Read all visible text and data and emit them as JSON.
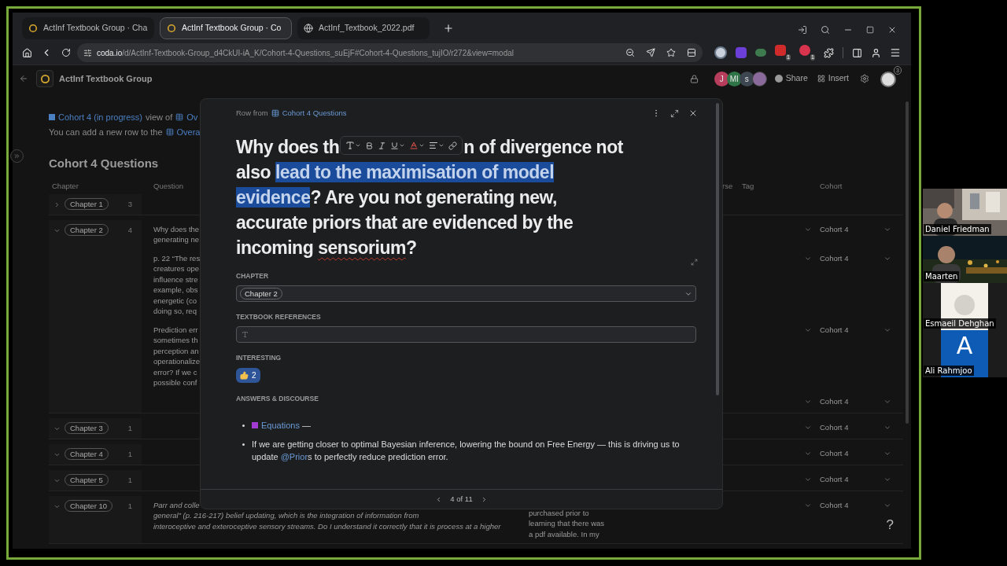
{
  "browser": {
    "tabs": [
      {
        "title": "ActInf Textbook Group · Cha",
        "kind": "doc",
        "selected": false
      },
      {
        "title": "ActInf Textbook Group · Co",
        "kind": "doc",
        "selected": true
      },
      {
        "title": "ActInf_Textbook_2022.pdf",
        "kind": "web",
        "selected": false
      }
    ],
    "url_host": "coda.io",
    "url_path": "/d/ActInf-Textbook-Group_d4CkUI-iA_K/Cohort-4-Questions_suEjF#Cohort-4-Questions_tujIO/r272&view=modal",
    "extension_badges": [
      "1",
      "1"
    ]
  },
  "doc": {
    "title": "ActInf Textbook Group",
    "members": [
      {
        "initial": "J",
        "color": "#b63d5c"
      },
      {
        "initial": "MI",
        "color": "#2e7446"
      },
      {
        "initial": "s",
        "color": "#3c4650"
      }
    ],
    "share": "Share",
    "insert": "Insert",
    "notification_count": "3"
  },
  "view": {
    "view_link": "Cohort 4 (in progress)",
    "view_of": "view of",
    "view_table": "Ov",
    "note": "You can add a new row to the",
    "note_table": "Overa",
    "heading": "Cohort 4 Questions",
    "columns": [
      "Chapter",
      "Question",
      "rse",
      "Tag",
      "Cohort"
    ],
    "groups": [
      {
        "chapter": "Chapter 1",
        "count": "3",
        "expanded": false
      },
      {
        "chapter": "Chapter 2",
        "count": "4",
        "expanded": true,
        "rows": [
          {
            "question_lines": [
              "Why does the",
              "generating ne"
            ],
            "italic": false,
            "cohort": "Cohort 4"
          },
          {
            "question_lines": [
              "p. 22 “The res",
              "creatures ope",
              "influence stre",
              "example, obs",
              "energetic (co",
              "doing so, req"
            ],
            "italic": false,
            "cohort": "Cohort 4"
          },
          {
            "question_lines": [
              "Prediction err",
              "sometimes th",
              "perception an",
              "operationalize",
              "error?  If we c",
              "possible conf"
            ],
            "italic": false,
            "cohort": "Cohort 4"
          },
          {
            "cohort": "Cohort 4"
          }
        ]
      },
      {
        "chapter": "Chapter 3",
        "count": "1",
        "expanded": true,
        "rows": [
          {
            "cohort": "Cohort 4"
          }
        ]
      },
      {
        "chapter": "Chapter 4",
        "count": "1",
        "expanded": true,
        "rows": [
          {
            "cohort": "Cohort 4"
          }
        ]
      },
      {
        "chapter": "Chapter 5",
        "count": "1",
        "expanded": true,
        "rows": [
          {
            "cohort": "Cohort 4"
          }
        ]
      },
      {
        "chapter": "Chapter 10",
        "count": "1",
        "expanded": true,
        "rows": [
          {
            "question_lines": [
              "Parr and colle",
              "general” (p. 216-217) belief updating, which is the integration of information from",
              "interoceptive and exteroceptive sensory streams. Do I understand it correctly that it is process at a higher"
            ],
            "italic": true,
            "column_3_lines": [
              "purchased prior to",
              "learning that there was",
              "a pdf available. In my"
            ],
            "cohort": "Cohort 4"
          }
        ]
      }
    ],
    "help": "?"
  },
  "modal": {
    "source_label": "Row from",
    "source_table": "Cohort 4 Questions",
    "title_lines": [
      [
        {
          "kind": "text",
          "text": "Why does th",
          "highlighted": false,
          "misspelled": false
        },
        {
          "kind": "toolbar"
        },
        {
          "kind": "text",
          "text": "n of divergence not",
          "highlighted": false,
          "misspelled": false
        }
      ],
      [
        {
          "kind": "text",
          "text": "also ",
          "highlighted": false,
          "misspelled": false
        },
        {
          "kind": "text",
          "text": "lead to the maximisation of model",
          "highlighted": true,
          "misspelled": false
        }
      ],
      [
        {
          "kind": "text",
          "text": "evidence",
          "highlighted": true,
          "misspelled": false
        },
        {
          "kind": "text",
          "text": "? Are you not generating new,",
          "highlighted": false,
          "misspelled": false
        }
      ],
      [
        {
          "kind": "text",
          "text": "accurate priors that are evidenced by the",
          "highlighted": false,
          "misspelled": false
        }
      ],
      [
        {
          "kind": "text",
          "text": "incoming ",
          "highlighted": false,
          "misspelled": false
        },
        {
          "kind": "text",
          "text": "sensorium",
          "highlighted": false,
          "misspelled": true
        },
        {
          "kind": "text",
          "text": "?",
          "highlighted": false,
          "misspelled": false
        }
      ]
    ],
    "chapter_label": "CHAPTER",
    "chapter_value": "Chapter 2",
    "references_label": "TEXTBOOK REFERENCES",
    "interesting_label": "INTERESTING",
    "reaction": {
      "count": "2",
      "reacted": true
    },
    "answers_label": "ANSWERS & DISCOURSE",
    "answers": [
      [
        {
          "text": "Equations",
          "link": true
        },
        {
          "text": " —",
          "link": false
        }
      ],
      [
        {
          "text": "If we are getting closer to optimal Bayesian inference, lowering the bound on Free Energy — this is driving us to update ",
          "link": false
        },
        {
          "text": "@Prior",
          "link": true
        },
        {
          "text": "s to perfectly reduce prediction error.",
          "link": false
        }
      ]
    ],
    "pager": "4 of 11"
  },
  "participants": [
    {
      "name": "Daniel Friedman",
      "kind": "video"
    },
    {
      "name": "Maarten",
      "kind": "video"
    },
    {
      "name": "Esmaeil Dehghan",
      "kind": "avatar"
    },
    {
      "name": "Ali Rahmjoo",
      "kind": "initial",
      "initial": "A",
      "color": "#0d5bb5"
    }
  ]
}
